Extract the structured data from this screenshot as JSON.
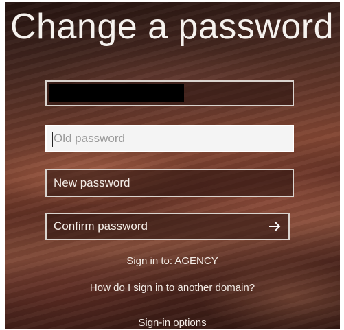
{
  "title": "Change a password",
  "username_field": {
    "value": ""
  },
  "old_password": {
    "placeholder": "Old password",
    "value": ""
  },
  "new_password": {
    "label": "New password"
  },
  "confirm_password": {
    "label": "Confirm password",
    "submit_icon": "arrow-right-icon"
  },
  "sign_in_to": "Sign in to: AGENCY",
  "other_domain_link": "How do I sign in to another domain?",
  "sign_in_options_link": "Sign-in options",
  "colors": {
    "text": "#ffffff",
    "field_border": "#d9d3ce",
    "focused_field_bg": "#f4f4f4"
  }
}
